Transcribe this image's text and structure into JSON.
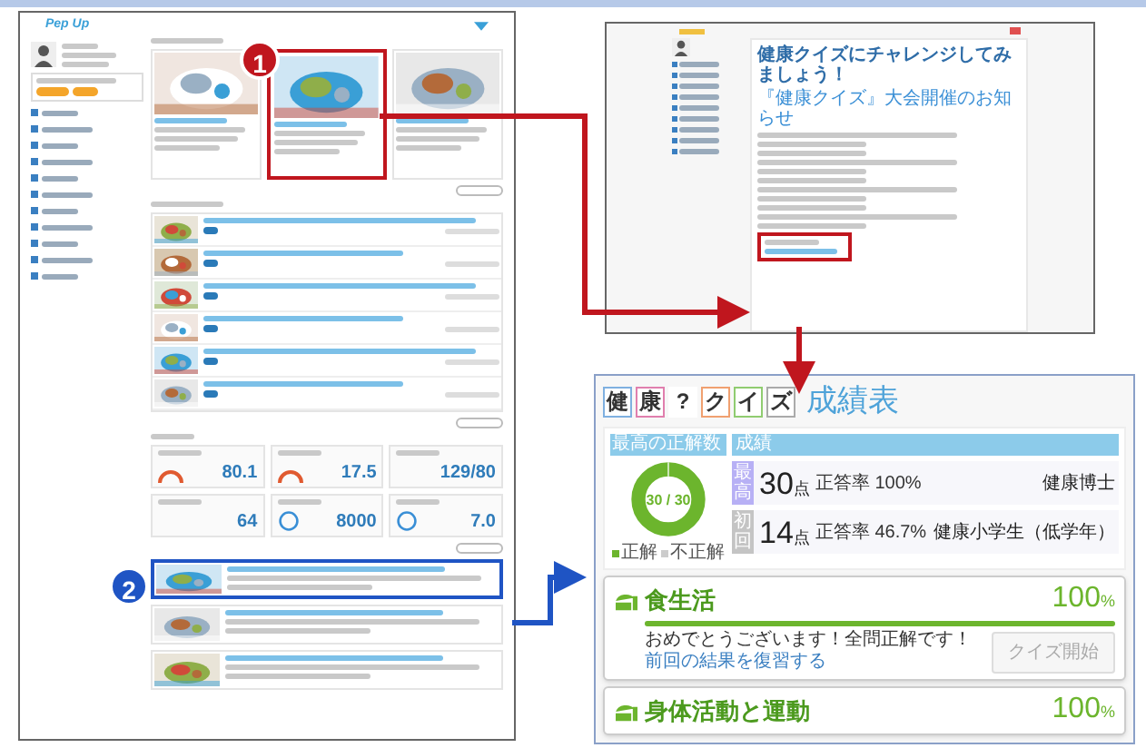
{
  "annotations": [
    {
      "label": "1",
      "color": "#c0161e"
    },
    {
      "label": "2",
      "color": "#1f54c4"
    }
  ],
  "main_page": {
    "logo": "Pep Up",
    "notices": [
      {
        "highlighted": false
      },
      {
        "highlighted": true
      },
      {
        "highlighted": false
      }
    ],
    "records": [
      {
        "value": "80.1",
        "kind": "arc"
      },
      {
        "value": "17.5",
        "kind": "arc"
      },
      {
        "value": "129/80",
        "kind": "plain"
      },
      {
        "value": "64",
        "kind": "plain"
      },
      {
        "value": "8000",
        "kind": "ring"
      },
      {
        "value": "7.0",
        "kind": "ring"
      }
    ],
    "banners": [
      {
        "highlighted": true
      },
      {
        "highlighted": false
      },
      {
        "highlighted": false
      }
    ]
  },
  "quiz_page": {
    "title": "健康クイズにチャレンジしてみましょう！",
    "heading": "『健康クイズ』大会開催のお知らせ"
  },
  "results": {
    "title_tiles": [
      {
        "char": "健",
        "color": "#7fb0e0"
      },
      {
        "char": "康",
        "color": "#e07fae"
      },
      {
        "char": "?",
        "color": "#ffffff"
      },
      {
        "char": "ク",
        "color": "#f0a070"
      },
      {
        "char": "イ",
        "color": "#90cc70"
      },
      {
        "char": "ズ",
        "color": "#aaaaaa"
      }
    ],
    "title": "成績表",
    "best_label": "最高の正解数",
    "donut_text": "30 / 30",
    "legend": [
      {
        "label": "正解",
        "color": "#6cb52d"
      },
      {
        "label": "不正解",
        "color": "#cccccc"
      }
    ],
    "scores_label": "成績",
    "scores": [
      {
        "tag": "最高",
        "points": "30",
        "unit": "点",
        "rate": "正答率 100%",
        "rank": "健康博士",
        "color": "#b7b0f5"
      },
      {
        "tag": "初回",
        "points": "14",
        "unit": "点",
        "rate": "正答率 46.7%",
        "rank": "健康小学生（低学年）",
        "color": "#c4c4c4"
      }
    ],
    "categories": [
      {
        "name": "食生活",
        "percent": "100",
        "unit": "%",
        "level": 1,
        "message": "おめでとうございます！全問正解です！",
        "review_link": "前回の結果を復習する",
        "button": "クイズ開始"
      },
      {
        "name": "身体活動と運動",
        "percent": "100",
        "unit": "%"
      }
    ]
  }
}
